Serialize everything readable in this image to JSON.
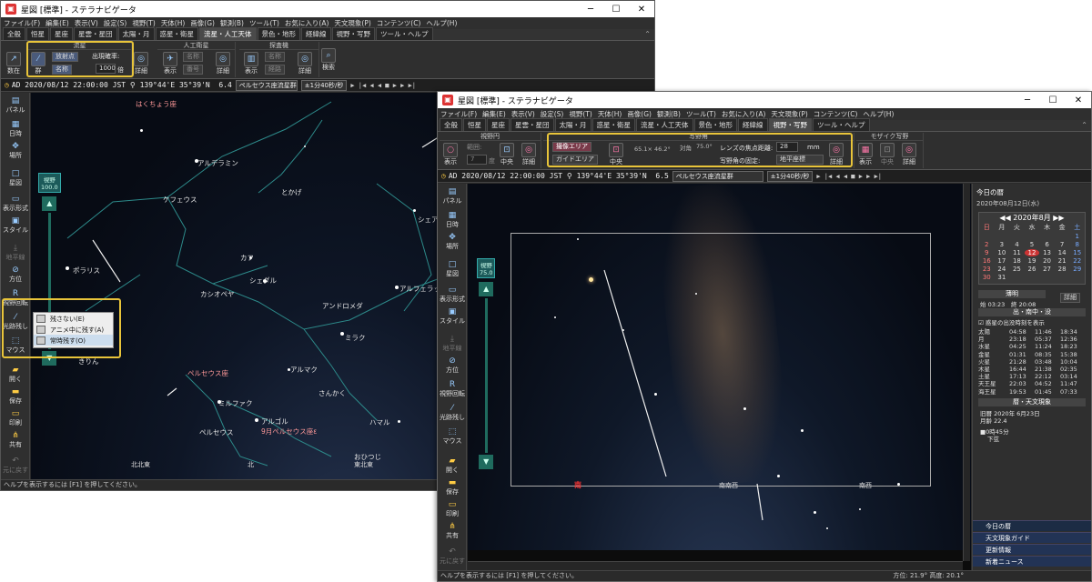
{
  "win1": {
    "title": "星図 [標準] - ステラナビゲータ",
    "menu": [
      "ファイル(F)",
      "編集(E)",
      "表示(V)",
      "設定(S)",
      "視野(T)",
      "天体(H)",
      "画像(G)",
      "観測(B)",
      "ツール(T)",
      "お気に入り(A)",
      "天文現象(P)",
      "コンテンツ(C)",
      "ヘルプ(H)"
    ],
    "tabs": [
      "全般",
      "恒星",
      "星座",
      "星雲・星団",
      "太陽・月",
      "惑星・衛星",
      "流星・人工天体",
      "景色・地形",
      "経緯線",
      "視野・写野",
      "ツール・ヘルプ"
    ],
    "ribbon": {
      "g_meteor": "流星",
      "g_sat": "人工衛星",
      "g_probe": "探査機",
      "btn_current": "数在",
      "btn_group": "群",
      "btn_radiant": "放射点",
      "btn_name": "名称",
      "rate_label": "出現確率:",
      "rate_value": "1000",
      "rate_unit": "倍",
      "btn_detail": "詳細",
      "btn_show": "表示",
      "btn_sat_name": "名称",
      "btn_number": "番号",
      "btn_detail2": "詳細",
      "btn_show2": "表示",
      "btn_probe_name": "名称",
      "btn_orbit": "経路",
      "btn_detail3": "詳細",
      "btn_search": "検索"
    },
    "info": {
      "era": "AD",
      "datetime": "2020/08/12 22:00:00",
      "tz": "JST",
      "coords": "139°44'E 35°39'N",
      "fov": "6.4",
      "target": "ペルセウス座流星群",
      "speed": "±1分40秒/秒"
    },
    "sidebar": [
      "パネル",
      "日時",
      "場所",
      "星図",
      "表示形式",
      "スタイル",
      "地平線",
      "方位",
      "視野回転",
      "光跡残し",
      "マウス",
      "開く",
      "保存",
      "印刷",
      "共有",
      "元に戻す"
    ],
    "fov_label": "視野",
    "fov_value": "100.0",
    "popup": [
      "残さない(E)",
      "アニメ中に残す(A)",
      "常時残す(O)"
    ],
    "labels": {
      "hakucho": "はくちょう座",
      "alderamin": "アルデラミン",
      "cepheus": "ケフェウス",
      "tokage": "とかげ",
      "polaris": "ポラリス",
      "caph": "カフ",
      "schedar": "シェダル",
      "cassiopeia": "カシオペヤ",
      "andromeda": "アンドロメダ",
      "alpheratz": "アルフェラッツ",
      "mirach": "ミラク",
      "almach": "アルマク",
      "perseus_const": "ペルセウス座",
      "mirfak": "ミルファク",
      "perseus": "ペルセウス",
      "sankaku": "さんかく",
      "algol": "アルゴル",
      "sept_perseus": "9月ペルセウス座ε",
      "hamal": "ハマル",
      "ohitsuji": "おひつじ",
      "kirin": "きりん",
      "scheat": "シェア"
    },
    "directions": [
      "北北東",
      "北",
      "東北東"
    ],
    "status": "ヘルプを表示するには [F1] を押してください。"
  },
  "win2": {
    "title": "星図 [標準] - ステラナビゲータ",
    "menu": [
      "ファイル(F)",
      "編集(E)",
      "表示(V)",
      "設定(S)",
      "視野(T)",
      "天体(H)",
      "画像(G)",
      "観測(B)",
      "ツール(T)",
      "お気に入り(A)",
      "天文現象(P)",
      "コンテンツ(C)",
      "ヘルプ(H)"
    ],
    "tabs": [
      "全般",
      "恒星",
      "星座",
      "星雲・星団",
      "太陽・月",
      "惑星・衛星",
      "流星・人工天体",
      "景色・地形",
      "経緯線",
      "視野・写野",
      "ツール・ヘルプ"
    ],
    "ribbon": {
      "g_fovcircle": "視野円",
      "g_photo": "写野角",
      "g_mosaic": "モザイク写野",
      "btn_show": "表示",
      "range_label": "範囲:",
      "range_value": "7",
      "range_unit": "度",
      "btn_center": "中央",
      "btn_detail": "詳細",
      "btn_sensor": "撮像エリア",
      "btn_guide": "ガイドエリア",
      "btn_center2": "中央",
      "dims": "65.1× 46.2°",
      "diag_label": "対角",
      "diag_value": "75.0°",
      "focal_label": "レンズの焦点距離:",
      "focal_value": "28",
      "focal_unit": "mm",
      "fix_label": "写野角の固定:",
      "fix_value": "地平座標",
      "btn_detail2": "詳細",
      "btn_show2": "表示",
      "btn_center3": "中央",
      "btn_detail3": "詳細"
    },
    "info": {
      "era": "AD",
      "datetime": "2020/08/12 22:00:00",
      "tz": "JST",
      "coords": "139°44'E 35°39'N",
      "fov": "6.5",
      "target": "ペルセウス座流星群",
      "speed": "±1分40秒/秒"
    },
    "sidebar": [
      "パネル",
      "日時",
      "場所",
      "星図",
      "表示形式",
      "スタイル",
      "地平線",
      "方位",
      "視野回転",
      "光跡残し",
      "マウス",
      "開く",
      "保存",
      "印刷",
      "共有",
      "元に戻す"
    ],
    "fov_label": "視野",
    "fov_value": "75.0",
    "directions": [
      "南",
      "南南西",
      "南西"
    ],
    "panel": {
      "title": "今日の暦",
      "date": "2020年08月12日(水)",
      "month": "2020年8月",
      "weekdays": [
        "日",
        "月",
        "火",
        "水",
        "木",
        "金",
        "土"
      ],
      "days": [
        "",
        "",
        "",
        "",
        "",
        "",
        "1",
        "2",
        "3",
        "4",
        "5",
        "6",
        "7",
        "8",
        "9",
        "10",
        "11",
        "12",
        "13",
        "14",
        "15",
        "16",
        "17",
        "18",
        "19",
        "20",
        "21",
        "22",
        "23",
        "24",
        "25",
        "26",
        "27",
        "28",
        "29",
        "30",
        "31",
        "",
        "",
        "",
        "",
        ""
      ],
      "twilight_title": "薄明",
      "twilight_start": "始 03:23",
      "twilight_end": "終 20:08",
      "detail": "詳細",
      "rise_title": "出・南中・没",
      "rise_check": "惑星の出没時刻を表示",
      "rise_rows": [
        [
          "太陽",
          "04:58",
          "11:46",
          "18:34"
        ],
        [
          "月",
          "23:18",
          "05:37",
          "12:36"
        ],
        [
          "水星",
          "04:25",
          "11:24",
          "18:23"
        ],
        [
          "金星",
          "01:31",
          "08:35",
          "15:38"
        ],
        [
          "火星",
          "21:28",
          "03:48",
          "10:04"
        ],
        [
          "木星",
          "16:44",
          "21:38",
          "02:35"
        ],
        [
          "土星",
          "17:13",
          "22:12",
          "03:14"
        ],
        [
          "天王星",
          "22:03",
          "04:52",
          "11:47"
        ],
        [
          "海王星",
          "19:53",
          "01:45",
          "07:33"
        ]
      ],
      "calendar_title": "暦・天文現象",
      "lunar": "旧暦 2020年 6月23日",
      "moon_age": "月齢 22.4",
      "moon_phase": "0時45分",
      "moon_phase2": "下弦",
      "links": [
        "今日の暦",
        "天文現象ガイド",
        "更新情報",
        "新着ニュース"
      ]
    },
    "status": "ヘルプを表示するには [F1] を押してください。",
    "status_right": "方位: 21.9°  高度: 20.1°"
  }
}
